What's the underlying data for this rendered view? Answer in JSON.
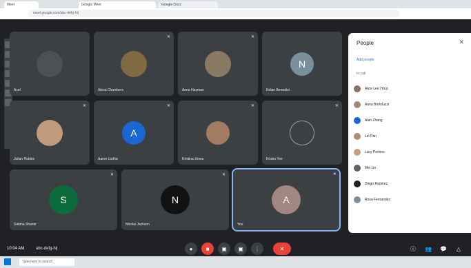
{
  "tabs": [
    "Meet",
    "Google Meet",
    "Google Docs"
  ],
  "address": "meet.google.com/abc-defg-hij",
  "tiles": [
    {
      "name": "Acel",
      "color": "#3c4043"
    },
    {
      "name": "Alexa Chambers",
      "color": "#3c4043"
    },
    {
      "name": "Anne Hayman",
      "color": "#3c4043"
    },
    {
      "name": "Nolan Benedict",
      "color": "#3c4043",
      "letter": "N",
      "avatar": "#78909c"
    },
    {
      "name": "Julian Robles",
      "color": "#3c4043"
    },
    {
      "name": "Aaron Lodha",
      "color": "#3c4043",
      "letter": "A",
      "avatar": "#1967d2"
    },
    {
      "name": "Kristina Jones",
      "color": "#3c4043"
    },
    {
      "name": "Kristin Yee",
      "color": "#3c4043"
    },
    {
      "name": "Sabina Shamir",
      "color": "#3c4043",
      "letter": "S",
      "avatar": "#0b6b3a"
    },
    {
      "name": "Nicolai Jackson",
      "color": "#3c4043",
      "letter": "N",
      "avatar": "#111"
    },
    {
      "name": "You",
      "color": "#3c4043",
      "letter": "A",
      "avatar": "#a1887f"
    }
  ],
  "time": "10:04 AM",
  "meeting_code": "abc-defg-hij",
  "panel": {
    "title": "People",
    "add": "Add people",
    "section": "In call",
    "people": [
      "Alice Lee (You)",
      "Anna Bortoluzzi",
      "Alan Zhang",
      "Lei Pan",
      "Lucy Perkins",
      "Mei Lin",
      "Diego Ramirez",
      "Rosa Fernandez"
    ]
  },
  "taskbar": {
    "search": "Type here to search"
  }
}
